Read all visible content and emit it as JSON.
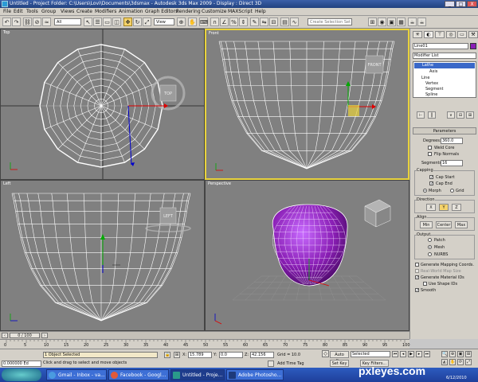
{
  "window": {
    "title": "Untitled    - Project Folder: C:\\Users\\Lovi\\Documents\\3dsmax    - Autodesk 3ds Max  2009        - Display : Direct 3D",
    "btn_min": "_",
    "btn_max": "□",
    "btn_close": "X"
  },
  "menu": [
    "File",
    "Edit",
    "Tools",
    "Group",
    "Views",
    "Create",
    "Modifiers",
    "Animation",
    "Graph Editors",
    "Rendering",
    "Customize",
    "MAXScript",
    "Help"
  ],
  "toolbar": {
    "filter_select": "All",
    "refcoord_select": "View",
    "selection_set_placeholder": "Create Selection Set"
  },
  "viewports": {
    "top": "Top",
    "front": "Front",
    "left": "Left",
    "perspective": "Perspective"
  },
  "viewcube": {
    "top": "TOP",
    "front": "FRONT",
    "left": "LEFT"
  },
  "colors": {
    "viewport_bg": "#808080",
    "active_border": "#e8d23c",
    "object_color": "#8a1fb5",
    "mesh_purple": "#9b2fd0"
  },
  "command_panel": {
    "object_name": "Line01",
    "modifier_list": "Modifier List",
    "stack": [
      "Lathe",
      "Axis",
      "Line",
      "Vertex",
      "Segment",
      "Spline"
    ],
    "rollout_title": "Parameters",
    "degrees_label": "Degrees:",
    "degrees_value": "360.0",
    "weld_core": "Weld Core",
    "flip_normals": "Flip Normals",
    "segments_label": "Segments:",
    "segments_value": "16",
    "capping_title": "Capping",
    "cap_start": "Cap Start",
    "cap_end": "Cap End",
    "morph": "Morph",
    "grid": "Grid",
    "direction_title": "Direction",
    "dir_x": "X",
    "dir_y": "Y",
    "dir_z": "Z",
    "align_title": "Align",
    "align_min": "Min",
    "align_center": "Center",
    "align_max": "Max",
    "output_title": "Output",
    "patch": "Patch",
    "mesh": "Mesh",
    "nurbs": "NURBS",
    "gen_mapping": "Generate Mapping Coords.",
    "real_world": "Real-World Map Size",
    "gen_material": "Generate Material IDs",
    "use_shape_ids": "Use Shape IDs",
    "smooth": "Smooth"
  },
  "timeline": {
    "frame_counter": "0 / 100",
    "ticks": [
      "0",
      "5",
      "10",
      "15",
      "20",
      "25",
      "30",
      "35",
      "40",
      "45",
      "50",
      "55",
      "60",
      "65",
      "70",
      "75",
      "80",
      "85",
      "90",
      "95",
      "100"
    ]
  },
  "status": {
    "selected": "1 Object Selected",
    "prompt": "Click and drag to select and move objects",
    "x_label": "X:",
    "x_value": "15.789",
    "y_label": "Y:",
    "y_value": "0.0",
    "z_label": "Z:",
    "z_value": "42.156",
    "grid": "Grid = 10.0",
    "add_time_tag": "Add Time Tag",
    "auto_key": "Auto Key",
    "auto_key_sel": "Selected",
    "set_key": "Set Key",
    "key_filters": "Key Filters...",
    "maxscript_field": "0.000000  Ed"
  },
  "taskbar": {
    "tasks": [
      "Gmail - Inbox - va...",
      "Facebook - Googl...",
      "Untitled  - Proje...",
      "Adobe Photosho..."
    ],
    "time": "6/12/2010"
  },
  "watermark": "pxleyes.com"
}
